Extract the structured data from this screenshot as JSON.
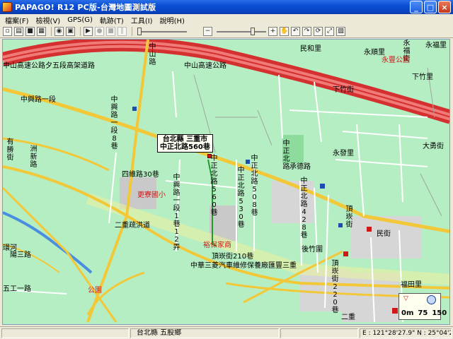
{
  "window": {
    "title": "PAPAGO! R12 PC版-台灣地圖測試版",
    "minimize_glyph": "_",
    "restore_glyph": "□",
    "close_glyph": "×"
  },
  "menu": {
    "items": [
      "檔案(F)",
      "檢視(V)",
      "GPS(G)",
      "軌跡(T)",
      "工具(I)",
      "說明(H)"
    ]
  },
  "toolbar": {
    "buttons": [
      "new-icon",
      "open-icon",
      "save-icon",
      "print-icon",
      "gps-icon",
      "pan-icon",
      "play-icon",
      "record-icon",
      "stop-icon",
      "pause-icon",
      "zoom-out-icon",
      "zoom-in-icon",
      "hand-icon",
      "rotate-left-icon",
      "rotate-right-icon",
      "rotate-icon",
      "fullscreen-icon",
      "layer-icon"
    ],
    "zoom_level": 0.78
  },
  "map": {
    "callout": {
      "line1": "台北縣 三重市",
      "line2": "中正北路560巷"
    },
    "labels": {
      "expressway": "中山高速公路",
      "expressway2": "中山高速公路夕五段高架道路",
      "zhongshan_road": "中山路",
      "minhe": "民和里",
      "yonghe_li": "永順里",
      "yongfu_st": "永福街",
      "yongfu_li": "永福里",
      "yongfeng_park": "永豐公園",
      "xiazhu_li": "下竹里",
      "xiazhu_st": "下竹街",
      "dading": "大丁",
      "zhongxing_1": "中興路一段",
      "zhongxing_1_8": "中興路一段8巷",
      "zhongxing_v": "中興路一段1巷12弄",
      "youli_st": "有勝街",
      "siwei": "四維路30巷",
      "gengliao_school": "更寮國小",
      "zhongzheng_n_560": "中正北路560巷",
      "zhongzheng_n_530": "中正北路530巷",
      "zhongzheng_n_508": "中正北路508巷",
      "zhongzheng_n_428": "中正北路428巷",
      "zhongzheng_n": "中正北路",
      "yonghe_li2": "永發里",
      "dayong": "大勇街",
      "chengde": "承德路",
      "second_ring": "二重疏洪道",
      "shuiluan_st": "頂崁街",
      "dingkan_210": "頂崁街210巷",
      "dingkan_220": "頂崁街220巷",
      "dingkan_st": "頂崁街",
      "houzhu": "後竹圍",
      "minguang": "民街",
      "yiguang": "福田里",
      "fitness": "中華三菱汽車維修保養廠匯豐三重",
      "wubu_park": "公園",
      "wugong": "五工一路",
      "jinian": "洲新路",
      "liangui": "環河",
      "yongan": "陽三路",
      "wugu_rd": "五工一路",
      "ererchong": "二重",
      "xinyuan": "台北縣 五股鄉",
      "park_sw": "公園",
      "yuanfu": "裕保家商"
    },
    "scale": {
      "zero": "0m",
      "mid": "75",
      "max": "150"
    }
  },
  "status": {
    "location": "台北縣 五股鄉",
    "coords": "E : 121°28'27.9\"  N : 25°04'26.4"
  }
}
